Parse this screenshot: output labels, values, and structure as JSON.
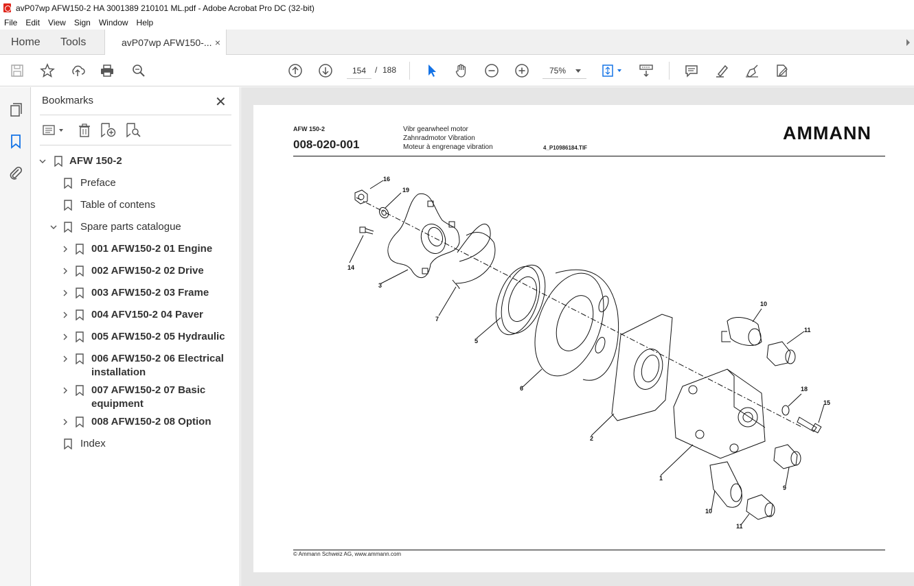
{
  "window": {
    "title": "avP07wp AFW150-2 HA 3001389 210101 ML.pdf - Adobe Acrobat Pro DC (32-bit)"
  },
  "menu": [
    "File",
    "Edit",
    "View",
    "Sign",
    "Window",
    "Help"
  ],
  "tabs": {
    "home": "Home",
    "tools": "Tools",
    "document": "avP07wp AFW150-...",
    "close": "×"
  },
  "toolbar": {
    "current_page": "154",
    "separator": "/",
    "total_pages": "188",
    "zoom": "75%",
    "icons_left": [
      "save-icon",
      "star-icon",
      "upload-icon",
      "print-icon",
      "zoom-search-icon"
    ],
    "icons_nav": [
      "page-up-icon",
      "page-down-icon"
    ],
    "icons_view": [
      "select-arrow-icon",
      "hand-icon",
      "zoom-out-icon",
      "zoom-in-icon"
    ],
    "icons_right": [
      "fit-page-icon",
      "scroll-mode-icon",
      "comment-icon",
      "highlight-icon",
      "sign-icon",
      "edit-pdf-icon"
    ]
  },
  "bookmarks": {
    "title": "Bookmarks",
    "close": "✕",
    "items": [
      {
        "label": "AFW 150-2",
        "bold": true
      },
      {
        "label": "Preface",
        "bold": false
      },
      {
        "label": "Table of contens",
        "bold": false
      },
      {
        "label": "Spare parts catalogue",
        "bold": false
      },
      {
        "label": "001 AFW150-2 01 Engine",
        "bold": true
      },
      {
        "label": "002 AFW150-2 02 Drive",
        "bold": true
      },
      {
        "label": "003 AFW150-2 03 Frame",
        "bold": true
      },
      {
        "label": "004 AFV150-2 04 Paver",
        "bold": true
      },
      {
        "label": "005 AFW150-2 05 Hydraulic",
        "bold": true
      },
      {
        "label_line1": "006 AFW150-2 06 Electrical",
        "label_line2": "installation",
        "bold": true
      },
      {
        "label_line1": "007 AFW150-2 07 Basic",
        "label_line2": "equipment",
        "bold": true
      },
      {
        "label": "008 AFW150-2 08 Option",
        "bold": true
      },
      {
        "label": "Index",
        "bold": false
      }
    ]
  },
  "document_page": {
    "model": "AFW 150-2",
    "code": "008-020-001",
    "desc_en": "Vibr gearwheel motor",
    "desc_de": "Zahnradmotor Vibration",
    "desc_fr": "Moteur à engrenage vibration",
    "file_ref": "4_P10986184.TIF",
    "logo": "AMMANN",
    "footer": "© Ammann Schweiz AG, www.ammann.com",
    "callouts": [
      "16",
      "19",
      "14",
      "3",
      "7",
      "5",
      "6",
      "2",
      "1",
      "10",
      "11",
      "18",
      "15",
      "9",
      "10",
      "11"
    ]
  }
}
